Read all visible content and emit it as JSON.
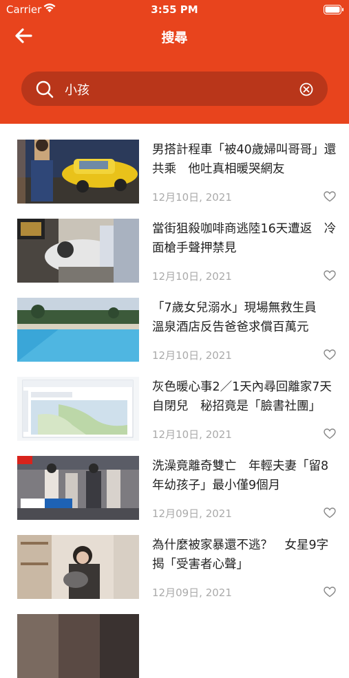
{
  "status_bar": {
    "carrier": "Carrier",
    "time": "3:55 PM"
  },
  "header": {
    "title": "搜尋"
  },
  "search": {
    "value": "小孩"
  },
  "colors": {
    "accent": "#e8441d",
    "search_bg": "#b9361a",
    "date": "#aaaaaa"
  },
  "articles": [
    {
      "title": "男搭計程車「被40歲婦叫哥哥」還共乘　他吐真相暖哭網友",
      "date": "12月10日, 2021"
    },
    {
      "title": "當街狙殺咖啡商逃陸16天遭返　冷面槍手聲押禁見",
      "date": "12月10日, 2021"
    },
    {
      "title": "「7歲女兒溺水」現場無救生員　溫泉酒店反告爸爸求償百萬元",
      "date": "12月10日, 2021"
    },
    {
      "title": "灰色暖心事2／1天內尋回離家7天自閉兒　秘招竟是「臉書社團」",
      "date": "12月10日, 2021"
    },
    {
      "title": "洗澡竟離奇雙亡　年輕夫妻「留8年幼孩子」最小僅9個月",
      "date": "12月09日, 2021"
    },
    {
      "title": "為什麼被家暴還不逃？　女星9字揭「受害者心聲」",
      "date": "12月09日, 2021"
    }
  ]
}
